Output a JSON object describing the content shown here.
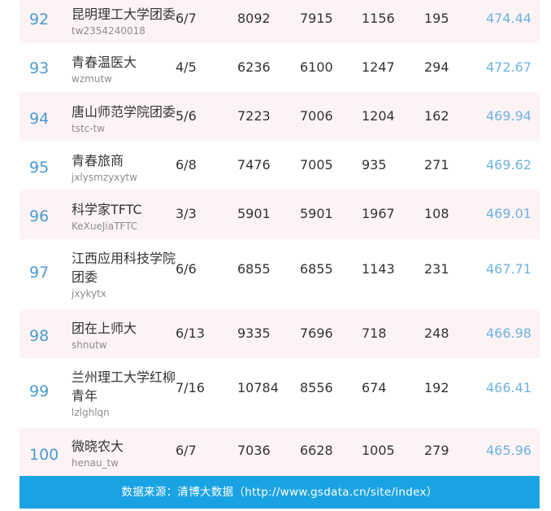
{
  "rows": [
    {
      "rank": "92",
      "name": "昆明理工大学团委",
      "account": "tw2354240018",
      "posts": "6/7",
      "total_reads": "8092",
      "max_reads": "7915",
      "avg_reads": "1156",
      "likes": "195",
      "index": "474.44"
    },
    {
      "rank": "93",
      "name": "青春温医大",
      "account": "wzmutw",
      "posts": "4/5",
      "total_reads": "6236",
      "max_reads": "6100",
      "avg_reads": "1247",
      "likes": "294",
      "index": "472.67"
    },
    {
      "rank": "94",
      "name": "唐山师范学院团委",
      "account": "tstc-tw",
      "posts": "5/6",
      "total_reads": "7223",
      "max_reads": "7006",
      "avg_reads": "1204",
      "likes": "162",
      "index": "469.94"
    },
    {
      "rank": "95",
      "name": "青春旅商",
      "account": "jxlysmzyxytw",
      "posts": "6/8",
      "total_reads": "7476",
      "max_reads": "7005",
      "avg_reads": "935",
      "likes": "271",
      "index": "469.62"
    },
    {
      "rank": "96",
      "name": "科学家TFTC",
      "account": "KeXueJiaTFTC",
      "posts": "3/3",
      "total_reads": "5901",
      "max_reads": "5901",
      "avg_reads": "1967",
      "likes": "108",
      "index": "469.01"
    },
    {
      "rank": "97",
      "name": "江西应用科技学院团委",
      "account": "jxykytx",
      "posts": "6/6",
      "total_reads": "6855",
      "max_reads": "6855",
      "avg_reads": "1143",
      "likes": "231",
      "index": "467.71"
    },
    {
      "rank": "98",
      "name": "团在上师大",
      "account": "shnutw",
      "posts": "6/13",
      "total_reads": "9335",
      "max_reads": "7696",
      "avg_reads": "718",
      "likes": "248",
      "index": "466.98"
    },
    {
      "rank": "99",
      "name": "兰州理工大学红柳青年",
      "account": "lzlghlqn",
      "posts": "7/16",
      "total_reads": "10784",
      "max_reads": "8556",
      "avg_reads": "674",
      "likes": "192",
      "index": "466.41"
    },
    {
      "rank": "100",
      "name": "微晓农大",
      "account": "henau_tw",
      "posts": "6/7",
      "total_reads": "7036",
      "max_reads": "6628",
      "avg_reads": "1005",
      "likes": "279",
      "index": "465.96"
    }
  ],
  "footer": {
    "source": "数据来源：清博大数据（http://www.gsdata.cn/site/index）"
  }
}
